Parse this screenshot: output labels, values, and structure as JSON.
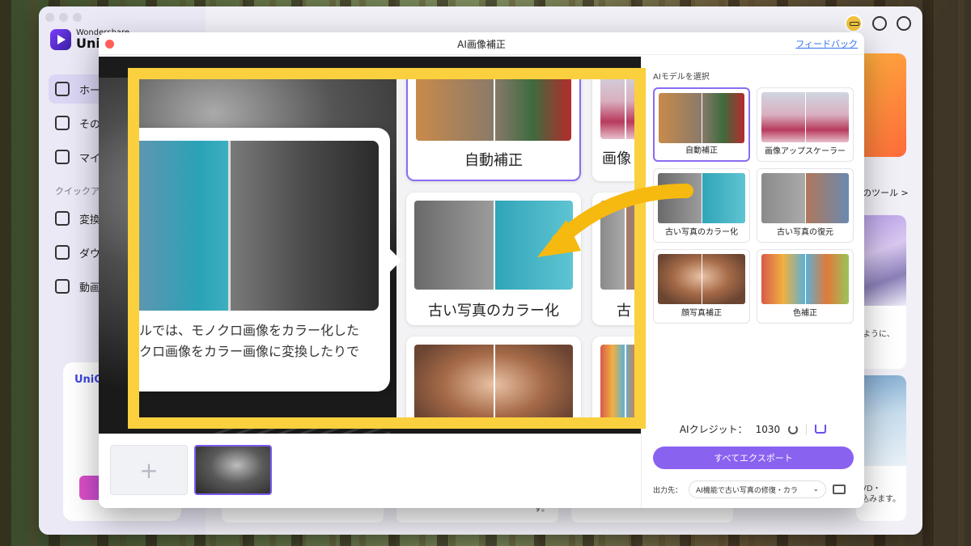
{
  "app": {
    "brand_sub": "Wondershare",
    "brand_name": "UniC",
    "nav": [
      {
        "label": "ホー",
        "active": true
      },
      {
        "label": "その"
      },
      {
        "label": "マイ"
      }
    ],
    "quick_section": "クイックア",
    "quick_items": [
      {
        "label": "変換"
      },
      {
        "label": "ダウ"
      },
      {
        "label": "動画"
      }
    ],
    "promo_title": "UniC",
    "tools_link": "のツール >",
    "card1_text": "ように、",
    "card2_text": "VD・\n込みます。",
    "bottom_text": "す。"
  },
  "dialog": {
    "title": "AI画像補正",
    "feedback": "フィードバック",
    "model_label": "AIモデルを選択",
    "models": [
      {
        "name": "自動補正",
        "icon": "cat-photo",
        "active": true
      },
      {
        "name": "画像アップスケーラー",
        "icon": "mountain-photo"
      },
      {
        "name": "古い写真のカラー化",
        "icon": "car-photo"
      },
      {
        "name": "古い写真の復元",
        "icon": "house-photo"
      },
      {
        "name": "顔写真補正",
        "icon": "face-photo"
      },
      {
        "name": "色補正",
        "icon": "colorful-town-photo"
      }
    ],
    "credit_label": "AIクレジット：",
    "credit_value": "1030",
    "export_button": "すべてエクスポート",
    "output_label": "出力先：",
    "output_value": "AI機能で古い写真の修復・カラ"
  },
  "zoom": {
    "card_auto": "自動補正",
    "card_upscale_partial": "画像",
    "card_colorize": "古い写真のカラー化",
    "card_partial2": "古",
    "tooltip_line1": "ルでは、モノクロ画像をカラー化した",
    "tooltip_line2": "クロ画像をカラー画像に変換したりで"
  },
  "colors": {
    "highlight": "#fbd03e",
    "accent": "#8a62f0",
    "arrow": "#f6b90f"
  }
}
